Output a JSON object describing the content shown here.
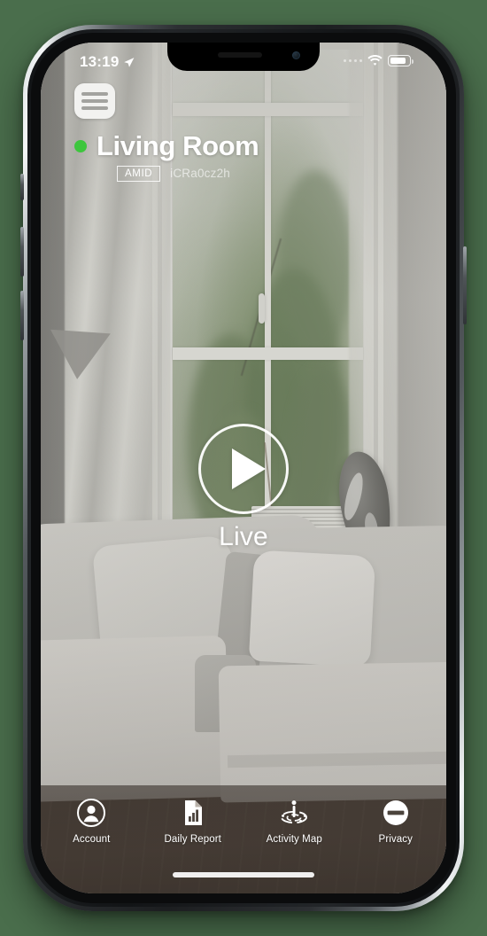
{
  "status_bar": {
    "time": "13:19",
    "location_icon": "location-arrow-icon",
    "signal_icon": "signal-dots-icon",
    "wifi_icon": "wifi-icon",
    "battery_icon": "battery-icon"
  },
  "header": {
    "menu_icon": "hamburger-menu-icon",
    "status_dot_color": "#3dc63d",
    "room_title": "Living Room",
    "badge_label": "AMID",
    "device_id": "iCRa0cz2h"
  },
  "player": {
    "play_icon": "play-icon",
    "live_label": "Live"
  },
  "tabbar": {
    "items": [
      {
        "label": "Account",
        "icon": "account-person-circle-icon"
      },
      {
        "label": "Daily Report",
        "icon": "document-bar-chart-icon"
      },
      {
        "label": "Activity Map",
        "icon": "activity-radar-person-icon"
      },
      {
        "label": "Privacy",
        "icon": "no-entry-minus-circle-icon"
      }
    ]
  },
  "system": {
    "home_indicator": "home-indicator"
  }
}
